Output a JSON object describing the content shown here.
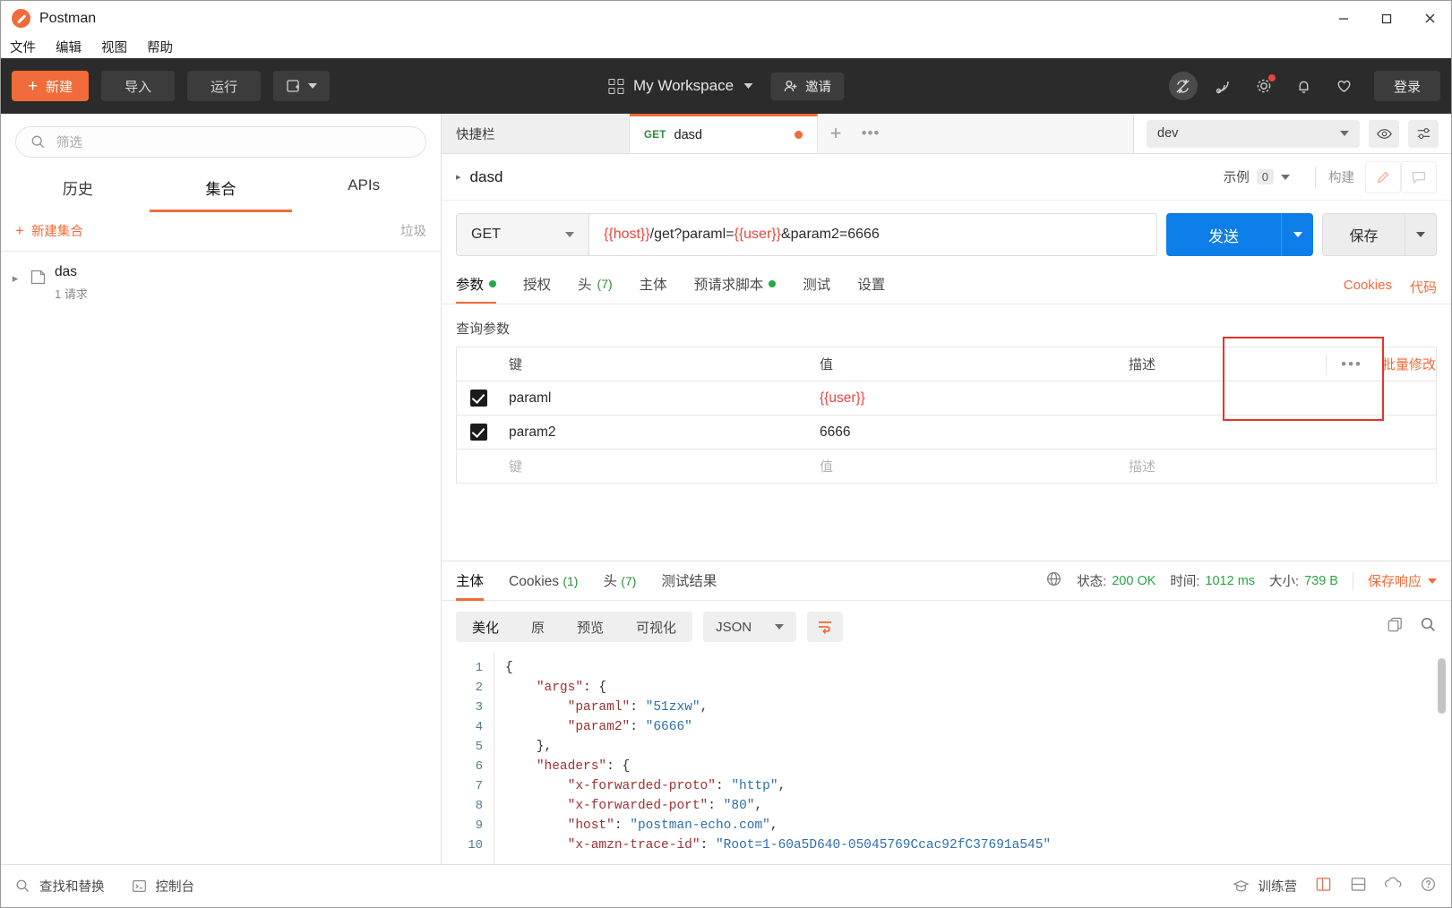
{
  "window": {
    "title": "Postman",
    "minimize": "—",
    "maximize": "▢",
    "close": "✕"
  },
  "menubar": {
    "items": [
      "文件",
      "编辑",
      "视图",
      "帮助"
    ]
  },
  "toolbar": {
    "new_label": "新建",
    "import_label": "导入",
    "runner_label": "运行",
    "workspace_label": "My Workspace",
    "invite_label": "邀请",
    "login_label": "登录",
    "icons": [
      "sync-off-icon",
      "satellite-icon",
      "gear-icon",
      "bell-icon",
      "heart-icon"
    ]
  },
  "sidebar": {
    "filter_placeholder": "筛选",
    "tabs": [
      {
        "label": "历史",
        "active": false
      },
      {
        "label": "集合",
        "active": true
      },
      {
        "label": "APIs",
        "active": false
      }
    ],
    "new_collection_label": "新建集合",
    "trash_label": "垃圾",
    "collection": {
      "name": "das",
      "meta": "1 请求"
    }
  },
  "tabstrip": {
    "tabs": [
      {
        "label": "快捷栏",
        "method": "",
        "active": false,
        "unsaved": false
      },
      {
        "label": "dasd",
        "method": "GET",
        "active": true,
        "unsaved": true
      }
    ],
    "add_label": "+",
    "more_label": "•••",
    "environment": "dev"
  },
  "request_header": {
    "name": "dasd",
    "examples_label": "示例",
    "examples_count": "0",
    "build_label": "构建"
  },
  "url_bar": {
    "method": "GET",
    "url_parts": [
      {
        "text": "{{host}}",
        "variable": true
      },
      {
        "text": "/get?paraml=",
        "variable": false
      },
      {
        "text": "{{user}}",
        "variable": true
      },
      {
        "text": "&param2=6666",
        "variable": false
      }
    ],
    "url_plain": "{{host}}/get?paraml={{user}}&param2=6666",
    "send_label": "发送",
    "save_label": "保存"
  },
  "request_tabs": {
    "items": [
      {
        "label": "参数",
        "dot": true,
        "count": "",
        "active": true
      },
      {
        "label": "授权",
        "dot": false,
        "count": "",
        "active": false
      },
      {
        "label": "头",
        "dot": false,
        "count": "(7)",
        "active": false
      },
      {
        "label": "主体",
        "dot": false,
        "count": "",
        "active": false
      },
      {
        "label": "预请求脚本",
        "dot": true,
        "count": "",
        "active": false
      },
      {
        "label": "测试",
        "dot": false,
        "count": "",
        "active": false
      },
      {
        "label": "设置",
        "dot": false,
        "count": "",
        "active": false
      }
    ],
    "cookies_label": "Cookies",
    "code_label": "代码"
  },
  "params": {
    "section_label": "查询参数",
    "columns": [
      "键",
      "值",
      "描述"
    ],
    "bulk_edit_label": "批量修改",
    "more_label": "•••",
    "rows": [
      {
        "checked": true,
        "key": "paraml",
        "value": "{{user}}",
        "value_is_variable": true,
        "desc": ""
      },
      {
        "checked": true,
        "key": "param2",
        "value": "6666",
        "value_is_variable": false,
        "desc": ""
      }
    ],
    "placeholder_row": {
      "key": "键",
      "value": "值",
      "desc": "描述"
    }
  },
  "response": {
    "tabs": [
      {
        "label": "主体",
        "count": "",
        "active": true
      },
      {
        "label": "Cookies",
        "count": "(1)",
        "active": false
      },
      {
        "label": "头",
        "count": "(7)",
        "active": false
      },
      {
        "label": "测试结果",
        "count": "",
        "active": false
      }
    ],
    "status_label": "状态:",
    "status_value": "200 OK",
    "time_label": "时间:",
    "time_value": "1012 ms",
    "size_label": "大小:",
    "size_value": "739 B",
    "save_response_label": "保存响应",
    "format_buttons": [
      "美化",
      "原",
      "预览",
      "可视化"
    ],
    "format_active": "美化",
    "content_type": "JSON",
    "wrap_icon": "wrap-text-icon",
    "copy_icon": "copy-icon",
    "search_icon": "search-icon",
    "body_lines": [
      {
        "n": "1",
        "tokens": [
          {
            "t": "{",
            "c": "p"
          }
        ]
      },
      {
        "n": "2",
        "tokens": [
          {
            "t": "    ",
            "c": "p"
          },
          {
            "t": "\"args\"",
            "c": "k"
          },
          {
            "t": ": {",
            "c": "p"
          }
        ]
      },
      {
        "n": "3",
        "tokens": [
          {
            "t": "        ",
            "c": "p"
          },
          {
            "t": "\"paraml\"",
            "c": "k"
          },
          {
            "t": ": ",
            "c": "p"
          },
          {
            "t": "\"51zxw\"",
            "c": "s"
          },
          {
            "t": ",",
            "c": "p"
          }
        ]
      },
      {
        "n": "4",
        "tokens": [
          {
            "t": "        ",
            "c": "p"
          },
          {
            "t": "\"param2\"",
            "c": "k"
          },
          {
            "t": ": ",
            "c": "p"
          },
          {
            "t": "\"6666\"",
            "c": "s"
          }
        ]
      },
      {
        "n": "5",
        "tokens": [
          {
            "t": "    },",
            "c": "p"
          }
        ]
      },
      {
        "n": "6",
        "tokens": [
          {
            "t": "    ",
            "c": "p"
          },
          {
            "t": "\"headers\"",
            "c": "k"
          },
          {
            "t": ": {",
            "c": "p"
          }
        ]
      },
      {
        "n": "7",
        "tokens": [
          {
            "t": "        ",
            "c": "p"
          },
          {
            "t": "\"x-forwarded-proto\"",
            "c": "k"
          },
          {
            "t": ": ",
            "c": "p"
          },
          {
            "t": "\"http\"",
            "c": "s"
          },
          {
            "t": ",",
            "c": "p"
          }
        ]
      },
      {
        "n": "8",
        "tokens": [
          {
            "t": "        ",
            "c": "p"
          },
          {
            "t": "\"x-forwarded-port\"",
            "c": "k"
          },
          {
            "t": ": ",
            "c": "p"
          },
          {
            "t": "\"80\"",
            "c": "s"
          },
          {
            "t": ",",
            "c": "p"
          }
        ]
      },
      {
        "n": "9",
        "tokens": [
          {
            "t": "        ",
            "c": "p"
          },
          {
            "t": "\"host\"",
            "c": "k"
          },
          {
            "t": ": ",
            "c": "p"
          },
          {
            "t": "\"postman-echo.com\"",
            "c": "s"
          },
          {
            "t": ",",
            "c": "p"
          }
        ]
      },
      {
        "n": "10",
        "tokens": [
          {
            "t": "        ",
            "c": "p"
          },
          {
            "t": "\"x-amzn-trace-id\"",
            "c": "k"
          },
          {
            "t": ": ",
            "c": "p"
          },
          {
            "t": "\"Root=1-60a5D640-05045769Ccac92fC37691a545\"",
            "c": "s"
          }
        ]
      }
    ]
  },
  "statusbar": {
    "find_replace_label": "查找和替换",
    "console_label": "控制台",
    "bootcamp_label": "训练营"
  },
  "colors": {
    "accent": "#f26b3a",
    "send_blue": "#0d7ee8",
    "status_green": "#26a844",
    "variable_red": "#e8453c",
    "annotation_red": "#e8332a",
    "toolbar_dark": "#2b2b2b"
  }
}
